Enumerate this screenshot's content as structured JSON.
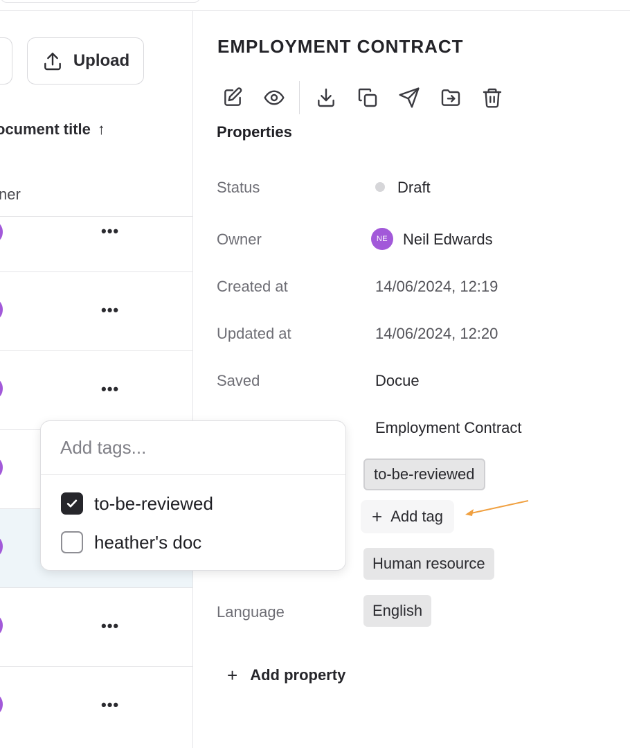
{
  "list": {
    "upload_label": "Upload",
    "column_title": "ocument title",
    "sort_arrow": "↑",
    "column_owner": "ner",
    "row_more_label": "•••"
  },
  "detail": {
    "title": "EMPLOYMENT CONTRACT",
    "section_title": "Properties",
    "properties": {
      "status_label": "Status",
      "status_value": "Draft",
      "owner_label": "Owner",
      "owner_initials": "NE",
      "owner_name": "Neil Edwards",
      "created_label": "Created at",
      "created_value": "14/06/2024, 12:19",
      "updated_label": "Updated at",
      "updated_value": "14/06/2024, 12:20",
      "saved_label": "Saved",
      "saved_value": "Docue",
      "template_value": "Employment Contract",
      "tag_value": "to-be-reviewed",
      "add_tag_label": "Add tag",
      "type_value": "Human resource",
      "language_label": "Language",
      "language_value": "English"
    },
    "add_property_label": "Add property"
  },
  "tags_popover": {
    "placeholder": "Add tags...",
    "options": [
      {
        "label": "to-be-reviewed",
        "checked": true
      },
      {
        "label": "heather's doc",
        "checked": false
      }
    ]
  },
  "colors": {
    "avatar": "#a259d9",
    "arrow": "#f0a040",
    "selected_row": "#eef5f9"
  }
}
